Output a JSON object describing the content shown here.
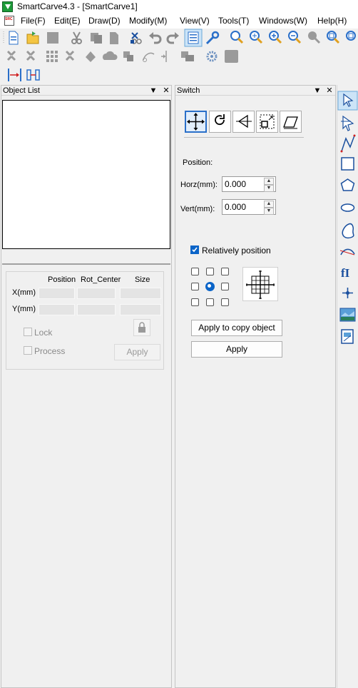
{
  "window": {
    "title": "SmartCarve4.3 - [SmartCarve1]"
  },
  "menu": {
    "items": [
      "File(F)",
      "Edit(E)",
      "Draw(D)",
      "Modify(M)",
      "View(V)",
      "Tools(T)",
      "Windows(W)",
      "Help(H)"
    ]
  },
  "toolbar": {
    "row1": [
      "new-file-icon",
      "open-folder-icon",
      "save-icon",
      "cut-icon",
      "copy-icon",
      "paste-icon",
      "delete-icon",
      "undo-icon",
      "redo-icon",
      "properties-icon",
      "wrench-icon",
      "zoom-icon",
      "zoom-fit-icon",
      "zoom-in-icon",
      "zoom-out-icon",
      "zoom-select-icon",
      "zoom-all-icon",
      "zoom-page-icon"
    ],
    "row2": [
      "group-icon",
      "ungroup-icon",
      "array-icon",
      "combine-icon",
      "weld-icon",
      "trim-icon",
      "intersect-icon",
      "node-edit-icon",
      "split-icon",
      "align-icon",
      "settings-icon",
      "fill-icon"
    ],
    "row3": [
      "distribute-horizontal-icon",
      "distribute-vertical-icon"
    ]
  },
  "object_list": {
    "title": "Object List",
    "columns": [
      "Position",
      "Rot_Center",
      "Size"
    ],
    "rows": [
      "X(mm)",
      "Y(mm)"
    ],
    "lock_label": "Lock",
    "process_label": "Process",
    "apply_label": "Apply"
  },
  "switch_panel": {
    "title": "Switch",
    "position_heading": "Position:",
    "horz_label": "Horz(mm):",
    "horz_value": "0.000",
    "vert_label": "Vert(mm):",
    "vert_value": "0.000",
    "relative_label": "Relatively position",
    "relative_checked": true,
    "apply_copy_label": "Apply to copy object",
    "apply_label": "Apply"
  },
  "right_toolbar": [
    "select-arrow-icon",
    "node-select-icon",
    "polyline-icon",
    "rectangle-icon",
    "polygon-icon",
    "ellipse-icon",
    "freehand-icon",
    "bezier-icon",
    "text-icon",
    "cross-icon",
    "image-icon",
    "vector-image-icon"
  ],
  "colors": {
    "accent": "#0a64c8",
    "title_bar": "#ffffff",
    "background": "#f0f0f0"
  }
}
